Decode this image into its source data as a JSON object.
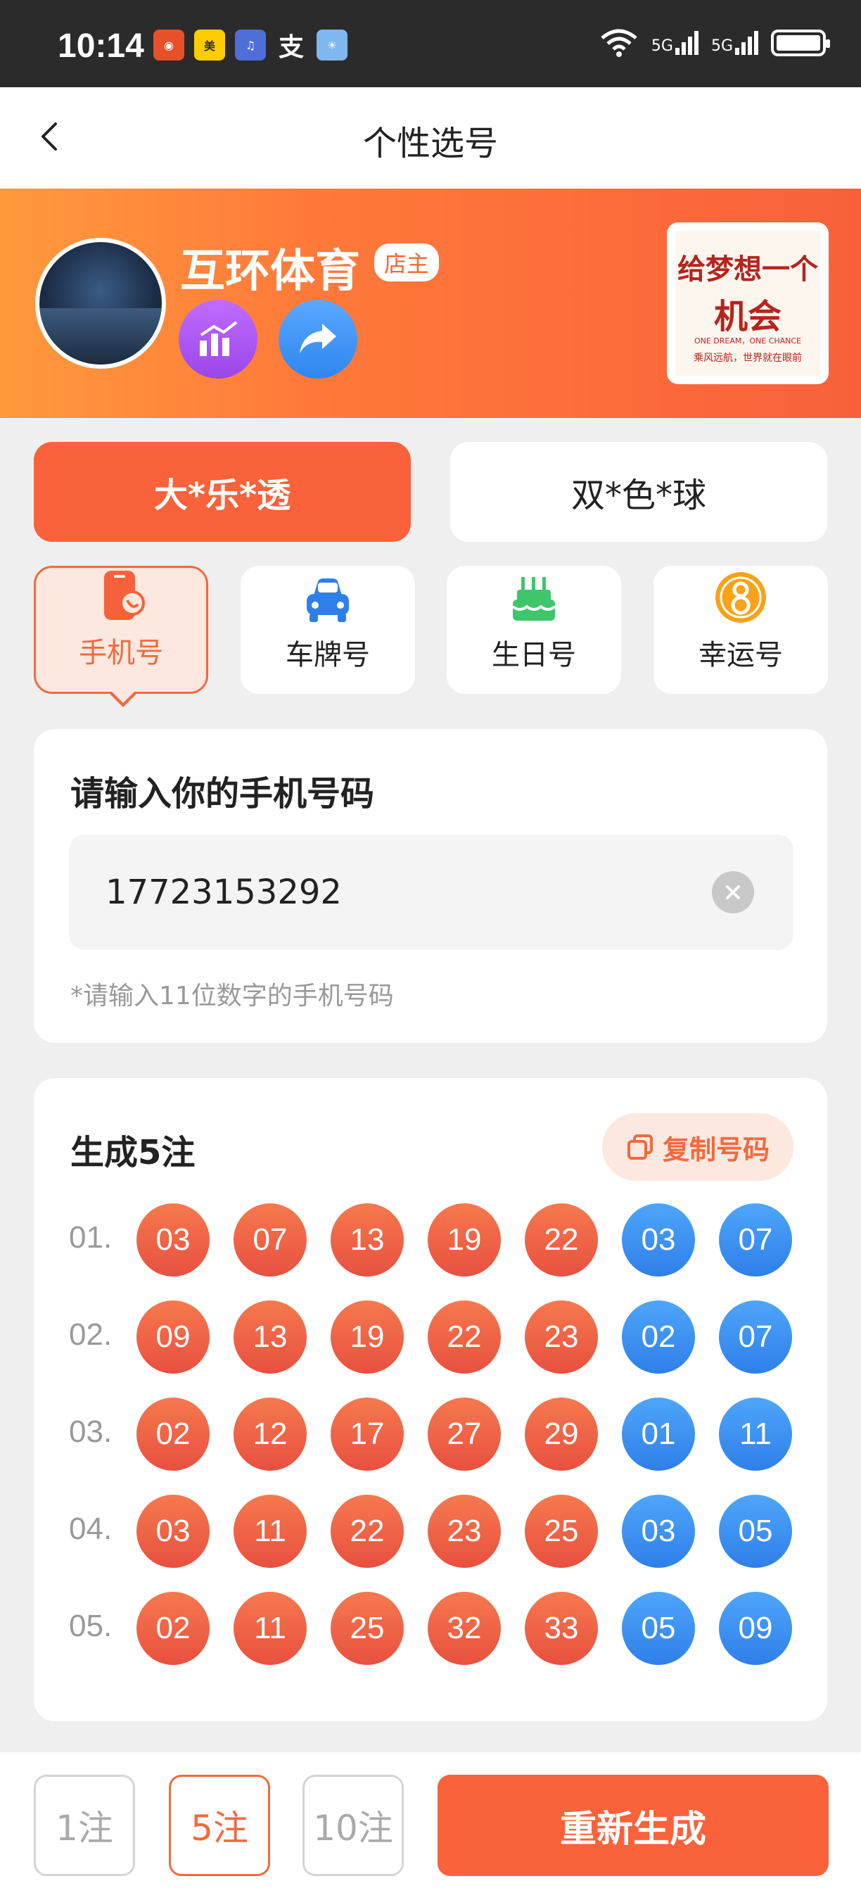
{
  "status_bar": {
    "time": "10:14",
    "signal1": "5G",
    "signal2": "5G"
  },
  "nav": {
    "title": "个性选号"
  },
  "shop": {
    "name": "互环体育",
    "badge": "店主"
  },
  "poster": {
    "line1": "给梦想一个",
    "line2": "机会",
    "line3": "ONE DREAM，ONE CHANCE",
    "line4": "乘风远航，世界就在眼前"
  },
  "lottery_tabs": [
    {
      "label": "大*乐*透",
      "active": true
    },
    {
      "label": "双*色*球",
      "active": false
    }
  ],
  "pick_types": [
    {
      "label": "手机号",
      "icon": "phone-icon",
      "active": true
    },
    {
      "label": "车牌号",
      "icon": "car-icon",
      "active": false
    },
    {
      "label": "生日号",
      "icon": "cake-icon",
      "active": false
    },
    {
      "label": "幸运号",
      "icon": "lucky-eight-icon",
      "active": false
    }
  ],
  "input_section": {
    "heading": "请输入你的手机号码",
    "value": "17723153292",
    "hint": "*请输入11位数字的手机号码"
  },
  "result": {
    "title": "生成5注",
    "copy_label": "复制号码",
    "rows": [
      {
        "index": "01.",
        "red": [
          "03",
          "07",
          "13",
          "19",
          "22"
        ],
        "blue": [
          "03",
          "07"
        ]
      },
      {
        "index": "02.",
        "red": [
          "09",
          "13",
          "19",
          "22",
          "23"
        ],
        "blue": [
          "02",
          "07"
        ]
      },
      {
        "index": "03.",
        "red": [
          "02",
          "12",
          "17",
          "27",
          "29"
        ],
        "blue": [
          "01",
          "11"
        ]
      },
      {
        "index": "04.",
        "red": [
          "03",
          "11",
          "22",
          "23",
          "25"
        ],
        "blue": [
          "03",
          "05"
        ]
      },
      {
        "index": "05.",
        "red": [
          "02",
          "11",
          "25",
          "32",
          "33"
        ],
        "blue": [
          "05",
          "09"
        ]
      }
    ]
  },
  "bottom": {
    "counts": [
      {
        "label": "1注",
        "active": false
      },
      {
        "label": "5注",
        "active": true
      },
      {
        "label": "10注",
        "active": false
      }
    ],
    "regenerate_label": "重新生成"
  },
  "colors": {
    "accent": "#f9623a",
    "red_ball": "#ec5a42",
    "blue_ball": "#3a8ff0"
  }
}
